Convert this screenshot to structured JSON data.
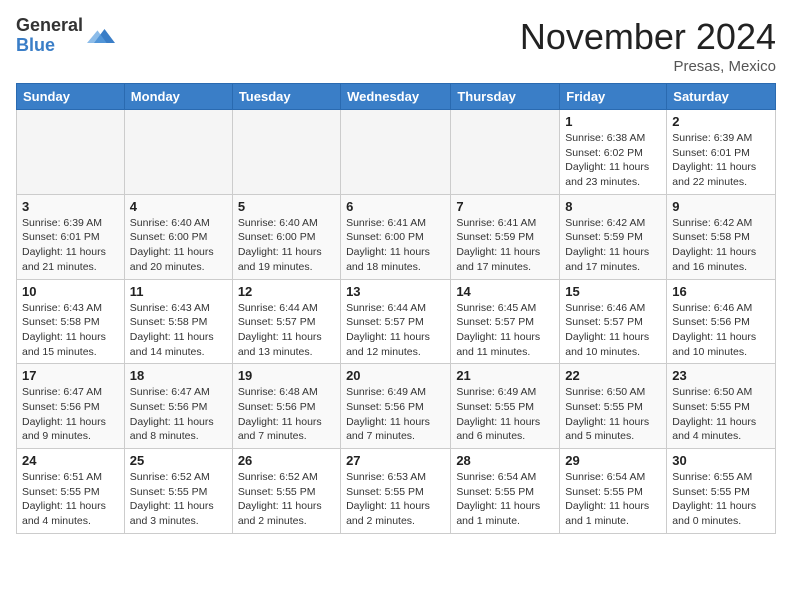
{
  "logo": {
    "general": "General",
    "blue": "Blue"
  },
  "header": {
    "title": "November 2024",
    "subtitle": "Presas, Mexico"
  },
  "weekdays": [
    "Sunday",
    "Monday",
    "Tuesday",
    "Wednesday",
    "Thursday",
    "Friday",
    "Saturday"
  ],
  "weeks": [
    [
      {
        "day": "",
        "info": ""
      },
      {
        "day": "",
        "info": ""
      },
      {
        "day": "",
        "info": ""
      },
      {
        "day": "",
        "info": ""
      },
      {
        "day": "",
        "info": ""
      },
      {
        "day": "1",
        "info": "Sunrise: 6:38 AM\nSunset: 6:02 PM\nDaylight: 11 hours and 23 minutes."
      },
      {
        "day": "2",
        "info": "Sunrise: 6:39 AM\nSunset: 6:01 PM\nDaylight: 11 hours and 22 minutes."
      }
    ],
    [
      {
        "day": "3",
        "info": "Sunrise: 6:39 AM\nSunset: 6:01 PM\nDaylight: 11 hours and 21 minutes."
      },
      {
        "day": "4",
        "info": "Sunrise: 6:40 AM\nSunset: 6:00 PM\nDaylight: 11 hours and 20 minutes."
      },
      {
        "day": "5",
        "info": "Sunrise: 6:40 AM\nSunset: 6:00 PM\nDaylight: 11 hours and 19 minutes."
      },
      {
        "day": "6",
        "info": "Sunrise: 6:41 AM\nSunset: 6:00 PM\nDaylight: 11 hours and 18 minutes."
      },
      {
        "day": "7",
        "info": "Sunrise: 6:41 AM\nSunset: 5:59 PM\nDaylight: 11 hours and 17 minutes."
      },
      {
        "day": "8",
        "info": "Sunrise: 6:42 AM\nSunset: 5:59 PM\nDaylight: 11 hours and 17 minutes."
      },
      {
        "day": "9",
        "info": "Sunrise: 6:42 AM\nSunset: 5:58 PM\nDaylight: 11 hours and 16 minutes."
      }
    ],
    [
      {
        "day": "10",
        "info": "Sunrise: 6:43 AM\nSunset: 5:58 PM\nDaylight: 11 hours and 15 minutes."
      },
      {
        "day": "11",
        "info": "Sunrise: 6:43 AM\nSunset: 5:58 PM\nDaylight: 11 hours and 14 minutes."
      },
      {
        "day": "12",
        "info": "Sunrise: 6:44 AM\nSunset: 5:57 PM\nDaylight: 11 hours and 13 minutes."
      },
      {
        "day": "13",
        "info": "Sunrise: 6:44 AM\nSunset: 5:57 PM\nDaylight: 11 hours and 12 minutes."
      },
      {
        "day": "14",
        "info": "Sunrise: 6:45 AM\nSunset: 5:57 PM\nDaylight: 11 hours and 11 minutes."
      },
      {
        "day": "15",
        "info": "Sunrise: 6:46 AM\nSunset: 5:57 PM\nDaylight: 11 hours and 10 minutes."
      },
      {
        "day": "16",
        "info": "Sunrise: 6:46 AM\nSunset: 5:56 PM\nDaylight: 11 hours and 10 minutes."
      }
    ],
    [
      {
        "day": "17",
        "info": "Sunrise: 6:47 AM\nSunset: 5:56 PM\nDaylight: 11 hours and 9 minutes."
      },
      {
        "day": "18",
        "info": "Sunrise: 6:47 AM\nSunset: 5:56 PM\nDaylight: 11 hours and 8 minutes."
      },
      {
        "day": "19",
        "info": "Sunrise: 6:48 AM\nSunset: 5:56 PM\nDaylight: 11 hours and 7 minutes."
      },
      {
        "day": "20",
        "info": "Sunrise: 6:49 AM\nSunset: 5:56 PM\nDaylight: 11 hours and 7 minutes."
      },
      {
        "day": "21",
        "info": "Sunrise: 6:49 AM\nSunset: 5:55 PM\nDaylight: 11 hours and 6 minutes."
      },
      {
        "day": "22",
        "info": "Sunrise: 6:50 AM\nSunset: 5:55 PM\nDaylight: 11 hours and 5 minutes."
      },
      {
        "day": "23",
        "info": "Sunrise: 6:50 AM\nSunset: 5:55 PM\nDaylight: 11 hours and 4 minutes."
      }
    ],
    [
      {
        "day": "24",
        "info": "Sunrise: 6:51 AM\nSunset: 5:55 PM\nDaylight: 11 hours and 4 minutes."
      },
      {
        "day": "25",
        "info": "Sunrise: 6:52 AM\nSunset: 5:55 PM\nDaylight: 11 hours and 3 minutes."
      },
      {
        "day": "26",
        "info": "Sunrise: 6:52 AM\nSunset: 5:55 PM\nDaylight: 11 hours and 2 minutes."
      },
      {
        "day": "27",
        "info": "Sunrise: 6:53 AM\nSunset: 5:55 PM\nDaylight: 11 hours and 2 minutes."
      },
      {
        "day": "28",
        "info": "Sunrise: 6:54 AM\nSunset: 5:55 PM\nDaylight: 11 hours and 1 minute."
      },
      {
        "day": "29",
        "info": "Sunrise: 6:54 AM\nSunset: 5:55 PM\nDaylight: 11 hours and 1 minute."
      },
      {
        "day": "30",
        "info": "Sunrise: 6:55 AM\nSunset: 5:55 PM\nDaylight: 11 hours and 0 minutes."
      }
    ]
  ]
}
